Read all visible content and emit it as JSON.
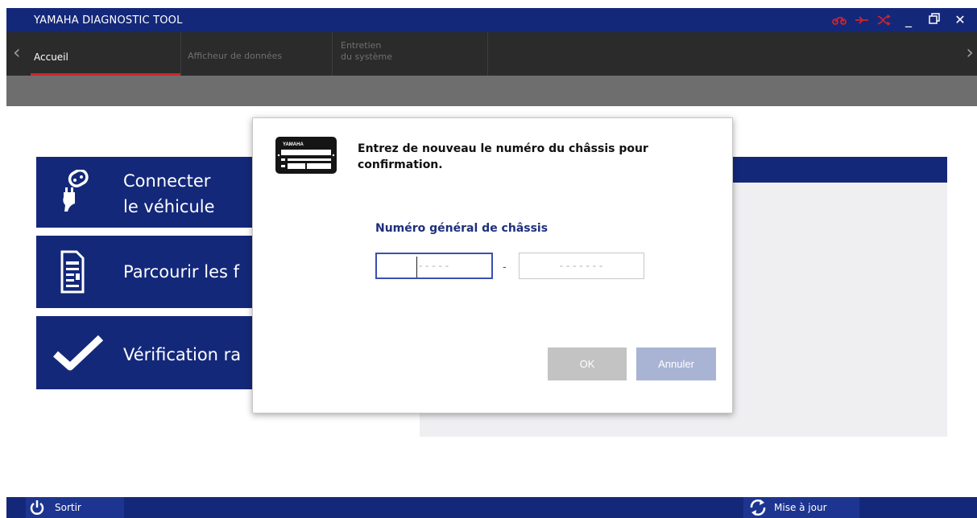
{
  "window": {
    "title": "YAMAHA DIAGNOSTIC TOOL",
    "accent_color": "#14287a",
    "status_icon_color": "#d2232a",
    "status_icons": [
      "motorcycle-icon",
      "connector-icon",
      "disconnect-icon"
    ],
    "controls": {
      "minimize": "_",
      "restore": "🗗",
      "close": "✕"
    }
  },
  "nav": {
    "tabs": [
      {
        "label": "Accueil",
        "active": true
      },
      {
        "label": "Afficheur de données",
        "active": false
      },
      {
        "label": "Entretien du système",
        "label_lines": [
          "Entretien",
          "du système"
        ],
        "active": false
      }
    ],
    "left_arrow": "‹",
    "right_arrow": "›"
  },
  "menu": {
    "connect": {
      "line1": "Connecter",
      "line2": "le véhicule",
      "icon": "plug-icon"
    },
    "browse": {
      "label": "Parcourir les f",
      "icon": "document-icon"
    },
    "verify": {
      "label": "Vérification ra",
      "icon": "checkmark-icon"
    }
  },
  "dialog": {
    "logo_text": "YAMAHA",
    "message_line1": "Entrez de nouveau le numéro du châssis pour",
    "message_line2": "confirmation.",
    "field_label": "Numéro général de châssis",
    "input1": {
      "value": "",
      "placeholder": "-----"
    },
    "separator": "-",
    "input2": {
      "value": "",
      "placeholder": "-------"
    },
    "ok_label": "OK",
    "cancel_label": "Annuler"
  },
  "statusbar": {
    "exit_label": "Sortir",
    "update_label": "Mise à jour"
  }
}
